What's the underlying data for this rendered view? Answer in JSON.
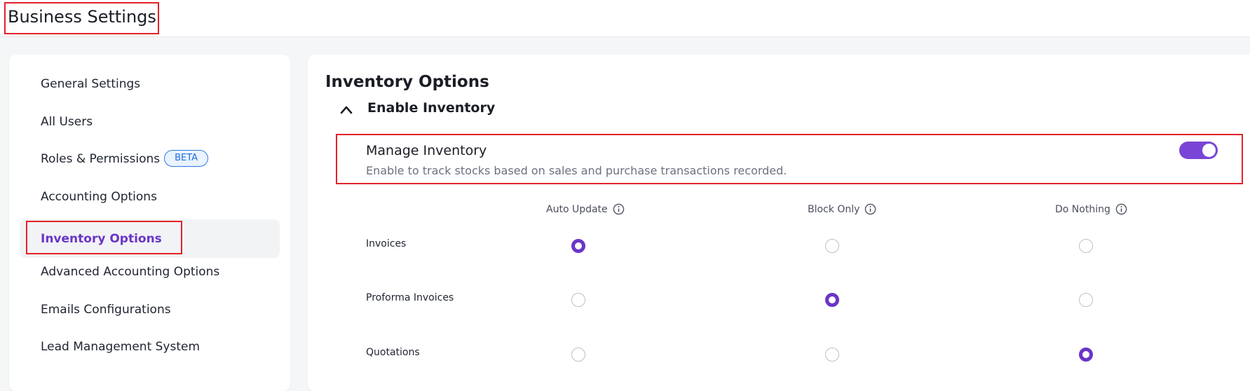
{
  "header": {
    "title": "Business Settings"
  },
  "sidebar": {
    "items": [
      {
        "label": "General Settings"
      },
      {
        "label": "All Users"
      },
      {
        "label": "Roles & Permissions",
        "badge": "BETA"
      },
      {
        "label": "Accounting Options"
      },
      {
        "label": "Inventory Options",
        "active": true
      },
      {
        "label": "Advanced Accounting Options"
      },
      {
        "label": "Emails Configurations"
      },
      {
        "label": "Lead Management System"
      }
    ]
  },
  "main": {
    "title": "Inventory Options",
    "section": {
      "title": "Enable Inventory",
      "expanded": true,
      "manage": {
        "title": "Manage Inventory",
        "description": "Enable to track stocks based on sales and purchase transactions recorded.",
        "enabled": true
      },
      "columns": [
        "Auto Update",
        "Block Only",
        "Do Nothing"
      ],
      "rows": [
        {
          "label": "Invoices",
          "selected": "Auto Update"
        },
        {
          "label": "Proforma Invoices",
          "selected": "Block Only"
        },
        {
          "label": "Quotations",
          "selected": "Do Nothing"
        }
      ]
    }
  },
  "colors": {
    "accent": "#6a35c8",
    "toggle_on": "#7a45d6",
    "highlight_border": "#e3222b",
    "badge_blue": "#1f6fd6"
  }
}
